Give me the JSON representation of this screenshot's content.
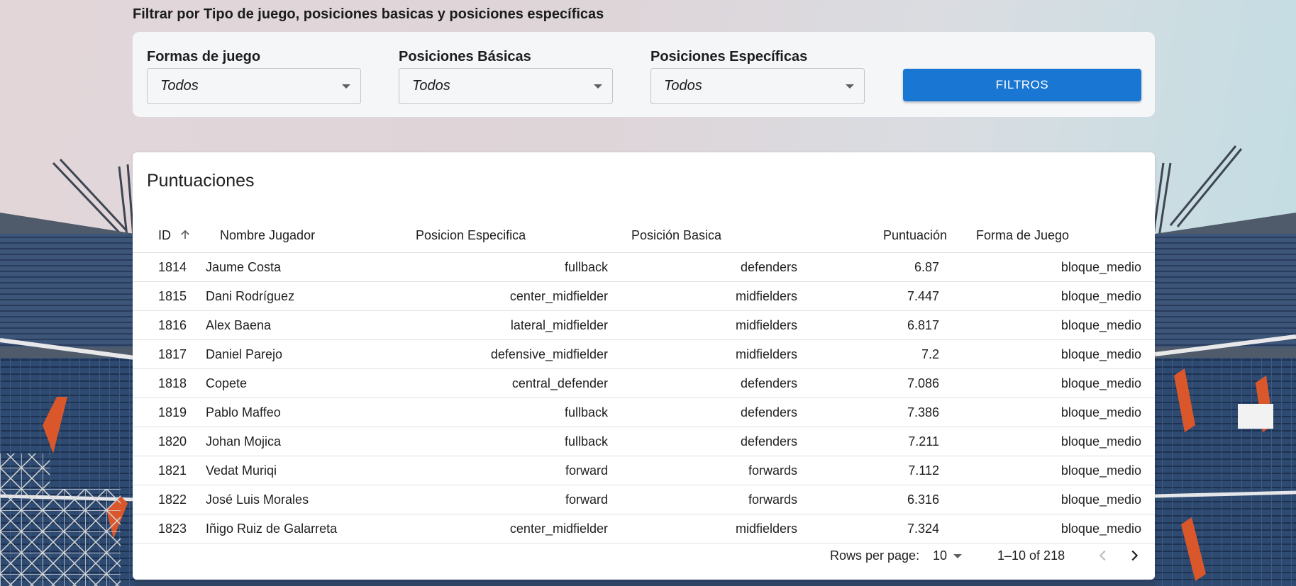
{
  "filters": {
    "heading": "Filtrar por Tipo de juego, posiciones basicas y posiciones específicas",
    "formas": {
      "label": "Formas de juego",
      "value": "Todos"
    },
    "basicas": {
      "label": "Posiciones Básicas",
      "value": "Todos"
    },
    "especificas": {
      "label": "Posiciones Específicas",
      "value": "Todos"
    },
    "button_label": "FILTROS"
  },
  "table": {
    "title": "Puntuaciones",
    "columns": [
      "ID",
      "Nombre Jugador",
      "Posicion Especifica",
      "Posición Basica",
      "Puntuación",
      "Forma de Juego"
    ],
    "sort_icon": "arrow-up-icon",
    "rows": [
      [
        "1814",
        "Jaume Costa",
        "fullback",
        "defenders",
        "6.87",
        "bloque_medio"
      ],
      [
        "1815",
        "Dani Rodríguez",
        "center_midfielder",
        "midfielders",
        "7.447",
        "bloque_medio"
      ],
      [
        "1816",
        "Alex Baena",
        "lateral_midfielder",
        "midfielders",
        "6.817",
        "bloque_medio"
      ],
      [
        "1817",
        "Daniel Parejo",
        "defensive_midfielder",
        "midfielders",
        "7.2",
        "bloque_medio"
      ],
      [
        "1818",
        "Copete",
        "central_defender",
        "defenders",
        "7.086",
        "bloque_medio"
      ],
      [
        "1819",
        "Pablo Maffeo",
        "fullback",
        "defenders",
        "7.386",
        "bloque_medio"
      ],
      [
        "1820",
        "Johan Mojica",
        "fullback",
        "defenders",
        "7.211",
        "bloque_medio"
      ],
      [
        "1821",
        "Vedat Muriqi",
        "forward",
        "forwards",
        "7.112",
        "bloque_medio"
      ],
      [
        "1822",
        "José Luis Morales",
        "forward",
        "forwards",
        "6.316",
        "bloque_medio"
      ],
      [
        "1823",
        "Iñigo Ruiz de Galarreta",
        "center_midfielder",
        "midfielders",
        "7.324",
        "bloque_medio"
      ]
    ]
  },
  "pagination": {
    "rows_per_page_label": "Rows per page:",
    "rows_per_page_value": "10",
    "range": "1–10 of 218",
    "prev_icon": "chevron-left-icon",
    "next_icon": "chevron-right-icon"
  },
  "colors": {
    "accent": "#1976d2",
    "seats_blue": "#2c4a73",
    "seats_orange": "#d9572b"
  }
}
